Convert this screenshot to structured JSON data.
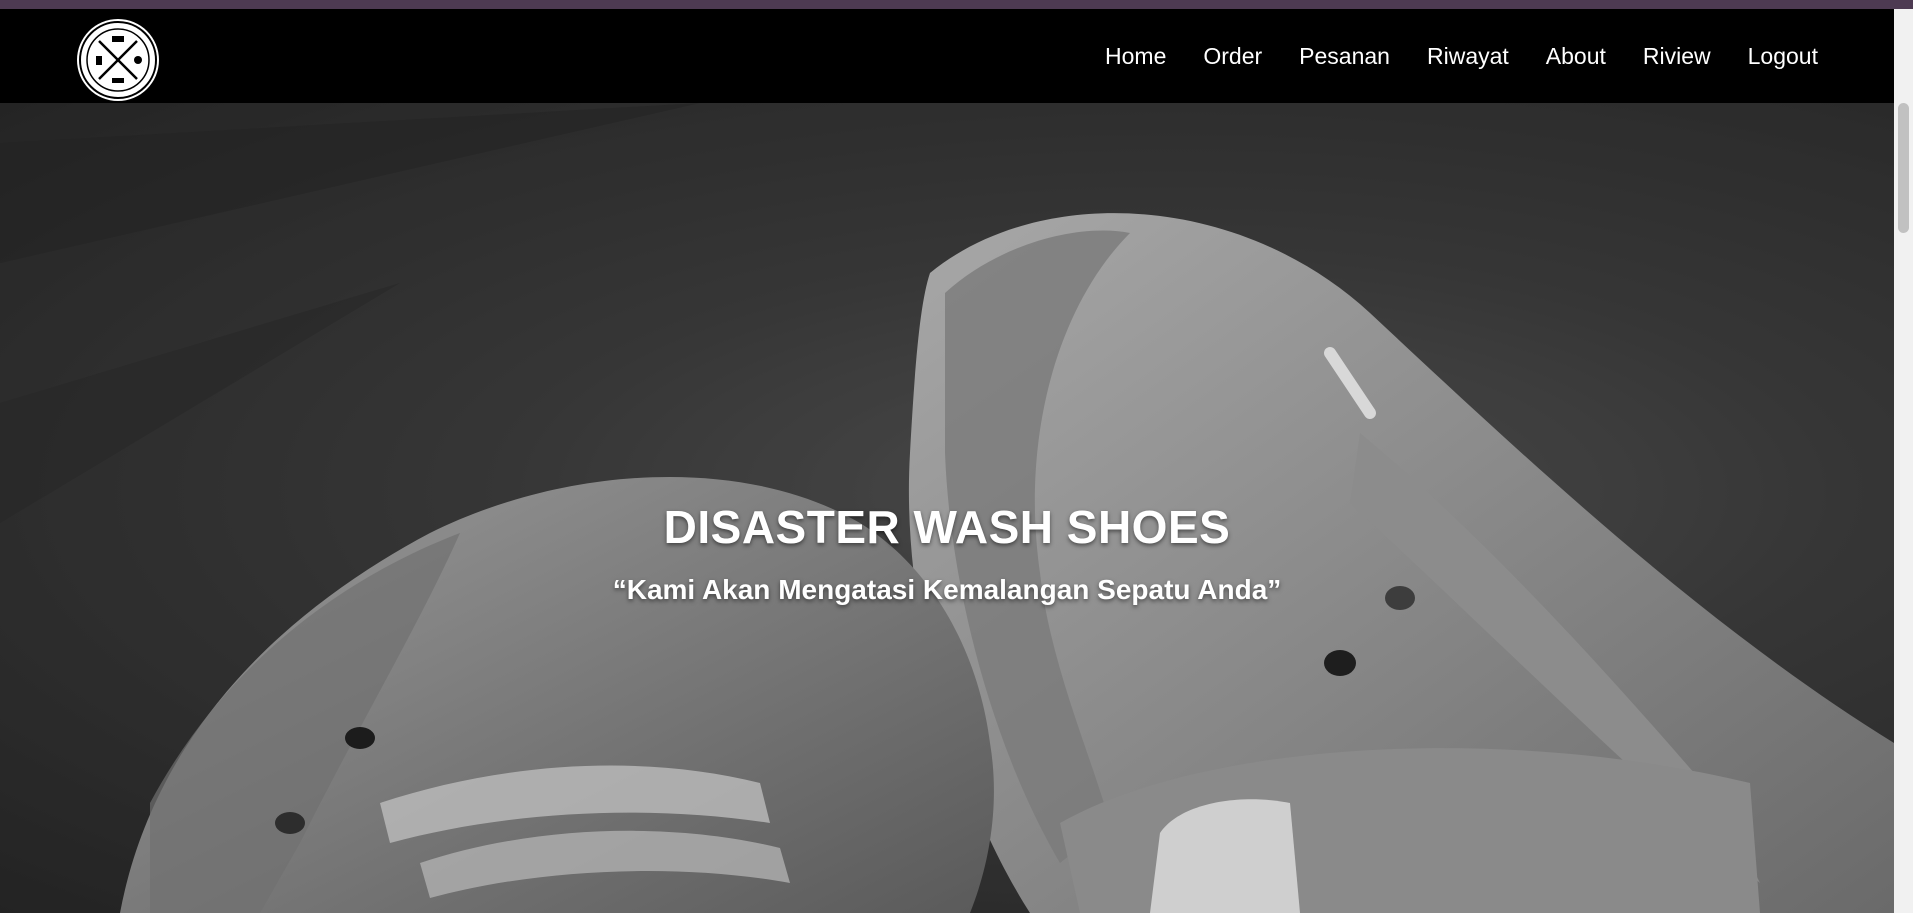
{
  "navbar": {
    "logo_icon": "brand-emblem-icon",
    "links": [
      {
        "label": "Home"
      },
      {
        "label": "Order"
      },
      {
        "label": "Pesanan"
      },
      {
        "label": "Riwayat"
      },
      {
        "label": "About"
      },
      {
        "label": "Riview"
      },
      {
        "label": "Logout"
      }
    ]
  },
  "hero": {
    "title": "DISASTER WASH SHOES",
    "subtitle": "“Kami Akan Mengatasi Kemalangan Sepatu Anda”",
    "background_icon": "worn-sneakers-photo"
  },
  "colors": {
    "top_strip": "#4d3a52",
    "navbar_bg": "#000000",
    "nav_text": "#ffffff",
    "hero_text": "#ffffff"
  }
}
